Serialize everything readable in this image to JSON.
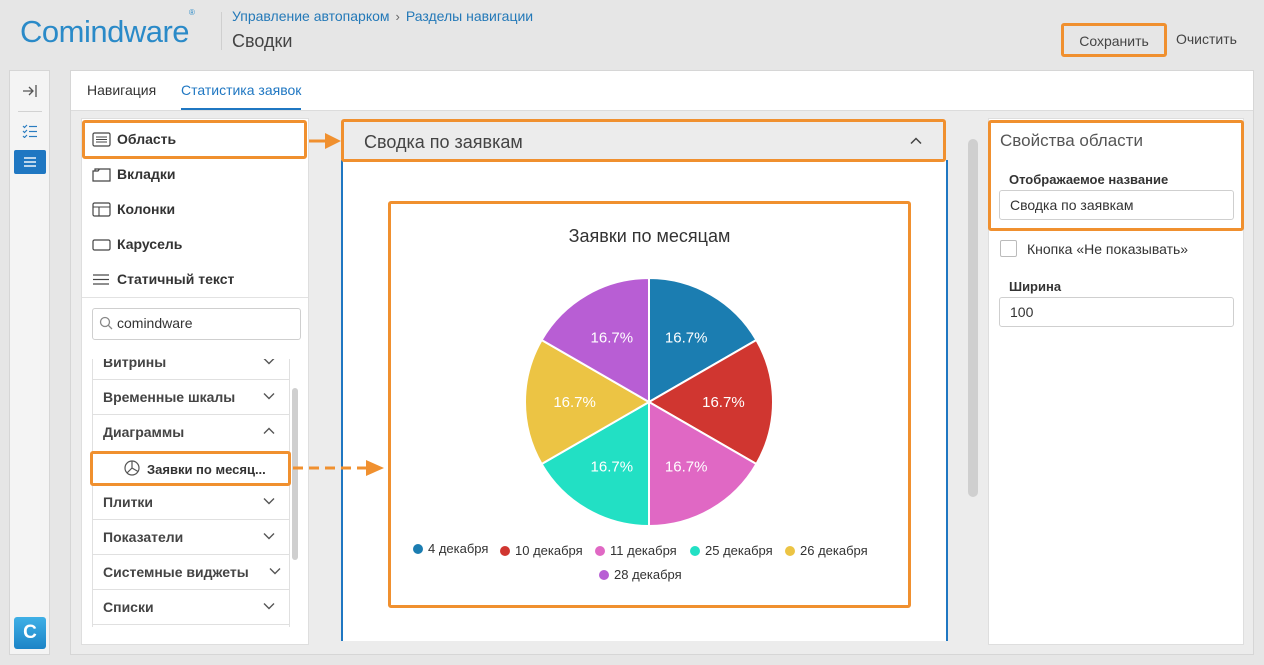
{
  "app": {
    "logo_text": "Comindware",
    "logo_mark": "®"
  },
  "breadcrumb": [
    "Управление автопарком",
    "Разделы навигации"
  ],
  "page_title": "Сводки",
  "toolbar": {
    "save_label": "Сохранить",
    "clear_label": "Очистить"
  },
  "tabs": [
    {
      "label": "Навигация",
      "active": false
    },
    {
      "label": "Статистика заявок",
      "active": true
    }
  ],
  "components": {
    "layout_items": [
      {
        "label": "Область",
        "icon": "list-box-icon"
      },
      {
        "label": "Вкладки",
        "icon": "folder-tabs-icon"
      },
      {
        "label": "Колонки",
        "icon": "columns-icon"
      },
      {
        "label": "Карусель",
        "icon": "carousel-icon"
      },
      {
        "label": "Статичный текст",
        "icon": "text-lines-icon"
      }
    ],
    "search_value": "comindware",
    "groups": [
      {
        "label": "Витрины",
        "expanded": false
      },
      {
        "label": "Временные шкалы",
        "expanded": false
      },
      {
        "label": "Диаграммы",
        "expanded": true
      },
      {
        "label": "Плитки",
        "expanded": false
      },
      {
        "label": "Показатели",
        "expanded": false
      },
      {
        "label": "Системные виджеты",
        "expanded": false
      },
      {
        "label": "Списки",
        "expanded": false
      }
    ],
    "chart_item_label": "Заявки по месяц..."
  },
  "area": {
    "title": "Сводка по заявкам"
  },
  "chart_data": {
    "type": "pie",
    "title": "Заявки по месяцам",
    "categories": [
      "4 декабря",
      "10 декабря",
      "11 декабря",
      "25 декабря",
      "26 декабря",
      "28 декабря"
    ],
    "values": [
      16.7,
      16.7,
      16.7,
      16.7,
      16.7,
      16.7
    ],
    "labels": [
      "16.7%",
      "16.7%",
      "16.7%",
      "16.7%",
      "16.7%",
      "16.7%"
    ],
    "colors": [
      "#1b7db1",
      "#d03630",
      "#e068c4",
      "#22e0c4",
      "#ecc444",
      "#b85ed4"
    ],
    "legend_position": "bottom"
  },
  "properties": {
    "title": "Свойства области",
    "display_name_label": "Отображаемое название",
    "display_name_value": "Сводка по заявкам",
    "hide_button_label": "Кнопка «Не показывать»",
    "hide_button_checked": false,
    "width_label": "Ширина",
    "width_value": "100"
  },
  "colors": {
    "accent": "#1f77c2",
    "highlight": "#f0902f"
  }
}
